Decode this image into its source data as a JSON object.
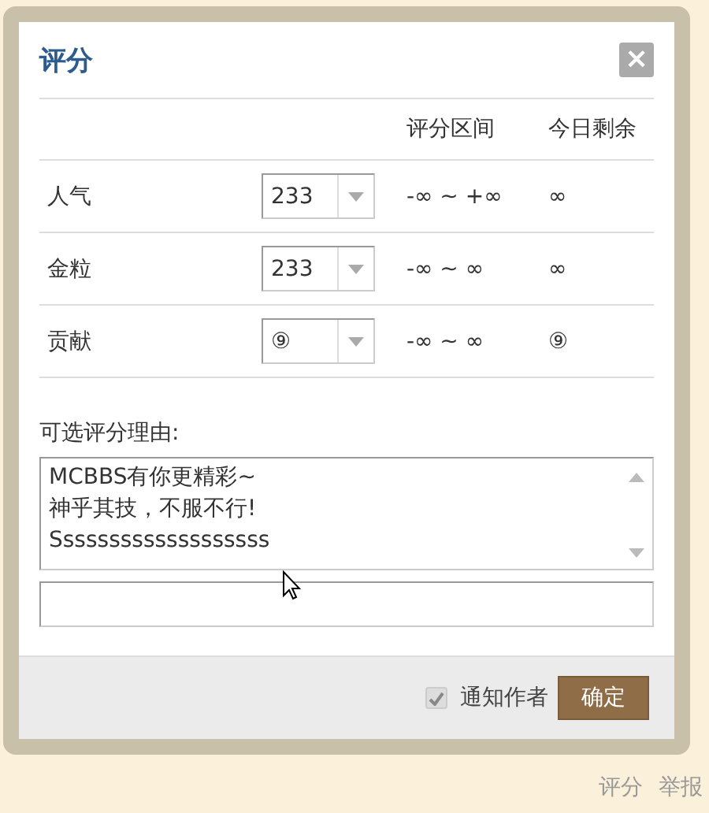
{
  "dialog": {
    "title": "评分",
    "close": "×"
  },
  "table": {
    "columns": [
      "评分区间",
      "今日剩余"
    ],
    "rows": [
      {
        "label": "人气",
        "value": "233",
        "range": "-∞ ~ +∞",
        "remaining": "∞"
      },
      {
        "label": "金粒",
        "value": "233",
        "range": "-∞ ~ ∞",
        "remaining": "∞"
      },
      {
        "label": "贡献",
        "value": "⑨",
        "range": "-∞ ~ ∞",
        "remaining": "⑨"
      }
    ]
  },
  "reason": {
    "label": "可选评分理由:",
    "options": [
      "MCBBS有你更精彩~",
      "神乎其技，不服不行!",
      "Sssssssssssssssssss"
    ]
  },
  "footer": {
    "notify": {
      "label": "通知作者",
      "checked": true
    },
    "submit": "确定"
  },
  "links": [
    "评分",
    "举报"
  ]
}
